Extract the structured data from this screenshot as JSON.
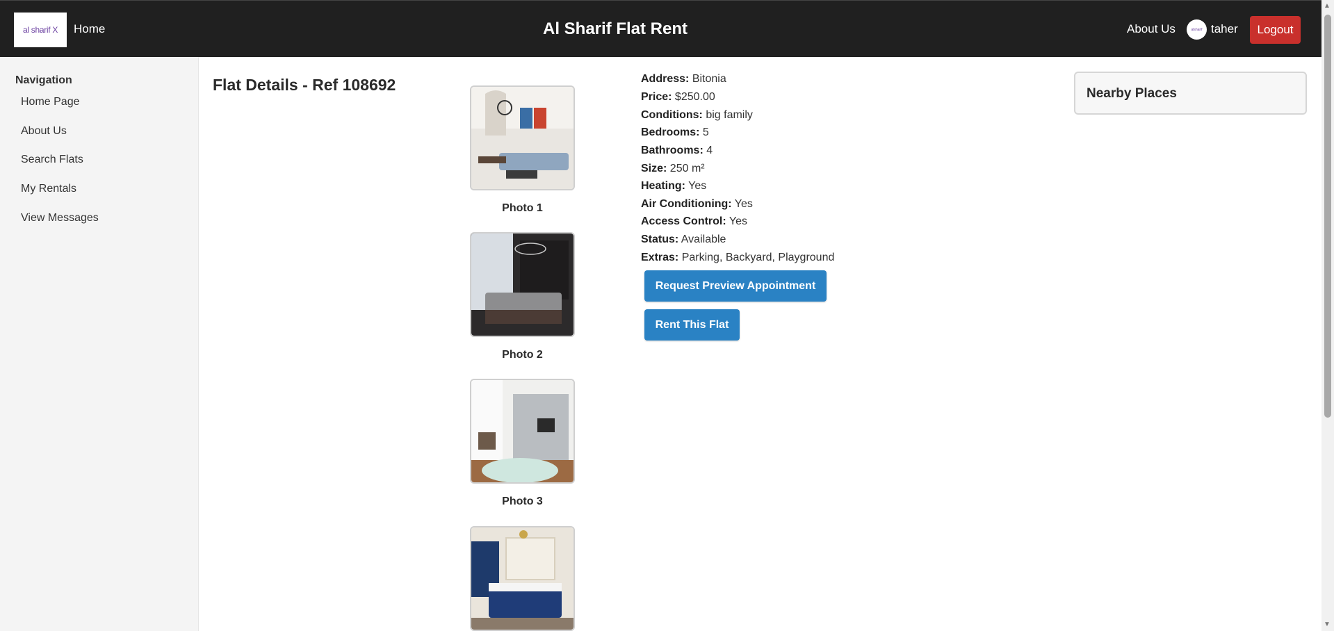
{
  "header": {
    "logo_text": "al sharif X",
    "home_label": "Home",
    "site_title": "Al Sharif Flat Rent",
    "about_label": "About Us",
    "avatar_text": "alsharif",
    "username": "taher",
    "logout_label": "Logout"
  },
  "sidebar": {
    "heading": "Navigation",
    "items": [
      {
        "label": "Home Page"
      },
      {
        "label": "About Us"
      },
      {
        "label": "Search Flats"
      },
      {
        "label": "My Rentals"
      },
      {
        "label": "View Messages"
      }
    ]
  },
  "flat": {
    "title": "Flat Details - Ref 108692",
    "photos": [
      {
        "caption": "Photo 1"
      },
      {
        "caption": "Photo 2"
      },
      {
        "caption": "Photo 3"
      }
    ],
    "details": [
      {
        "label": "Address:",
        "value": "Bitonia"
      },
      {
        "label": "Price:",
        "value": "$250.00"
      },
      {
        "label": "Conditions:",
        "value": "big family"
      },
      {
        "label": "Bedrooms:",
        "value": "5"
      },
      {
        "label": "Bathrooms:",
        "value": "4"
      },
      {
        "label": "Size:",
        "value": "250 m²"
      },
      {
        "label": "Heating:",
        "value": "Yes"
      },
      {
        "label": "Air Conditioning:",
        "value": "Yes"
      },
      {
        "label": "Access Control:",
        "value": "Yes"
      },
      {
        "label": "Status:",
        "value": "Available"
      },
      {
        "label": "Extras:",
        "value": "Parking, Backyard, Playground"
      }
    ],
    "request_button": "Request Preview Appointment",
    "rent_button": "Rent This Flat"
  },
  "nearby": {
    "title": "Nearby Places"
  },
  "colors": {
    "header_bg": "#202020",
    "logout_bg": "#c9302c",
    "button_bg": "#2a82c4",
    "sidebar_bg": "#f4f4f4"
  }
}
